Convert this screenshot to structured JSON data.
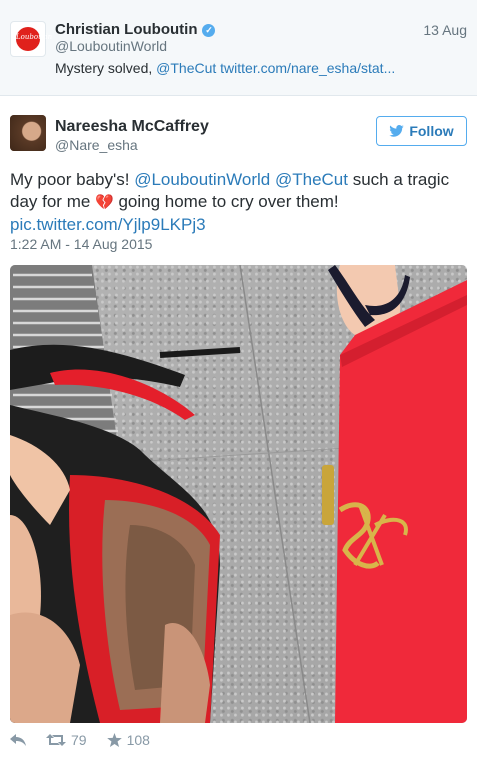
{
  "quoted_tweet": {
    "name": "Christian Louboutin",
    "avatar_text": "Louboutin",
    "handle": "@LouboutinWorld",
    "date": "13 Aug",
    "text_prefix": "Mystery solved, ",
    "mention": "@TheCut",
    "link": "twitter.com/nare_esha/stat..."
  },
  "tweet": {
    "name": "Nareesha McCaffrey",
    "handle": "@Nare_esha",
    "follow_label": "Follow",
    "text_1": "My poor baby's! ",
    "mention_1": "@LouboutinWorld",
    "mention_2": "@TheCut",
    "text_2": " such a tragic day for me ",
    "text_3": " going home to cry over them!",
    "pic_link": "pic.twitter.com/Yjlp9LKPj3",
    "timestamp": "1:22 AM - 14 Aug 2015",
    "retweets": "79",
    "favorites": "108"
  },
  "colors": {
    "link": "#2b7bb9",
    "follow_border": "#55acee",
    "bag_red": "#f0293a",
    "sole_red": "#e41f2b"
  }
}
